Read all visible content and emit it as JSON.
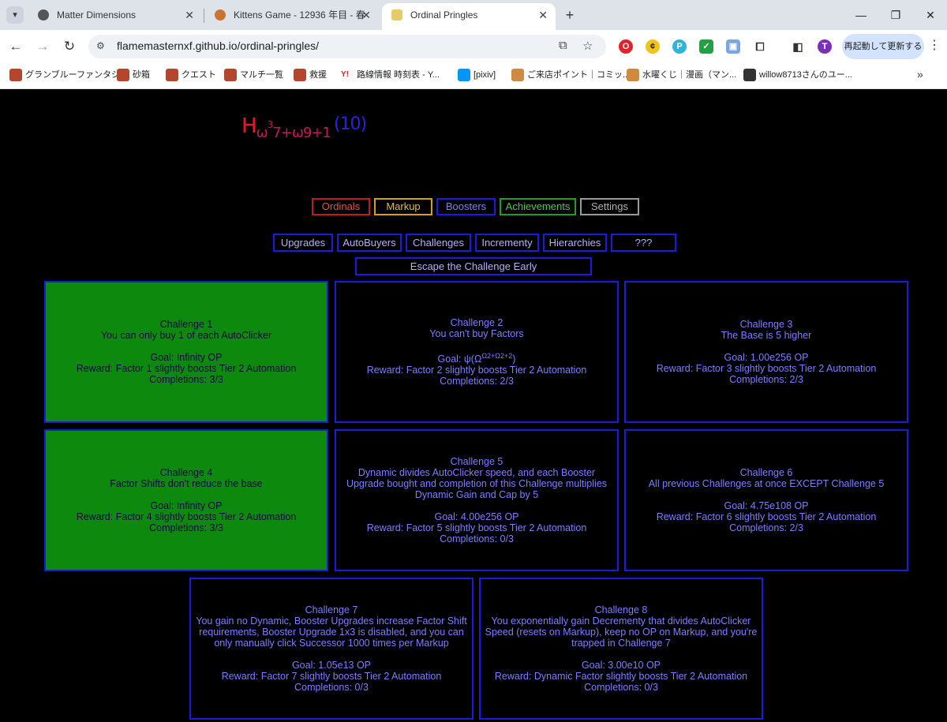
{
  "browser": {
    "tabs": [
      {
        "title": "Matter Dimensions",
        "active": false
      },
      {
        "title": "Kittens Game - 12936 年目 - 春",
        "active": false
      },
      {
        "title": "Ordinal Pringles",
        "active": true
      }
    ],
    "url": "flamemasternxf.github.io/ordinal-pringles/",
    "update_button": "再起動して更新する",
    "profile_initial": "T",
    "bookmarks": [
      "グランブルーファンタジー",
      "砂箱",
      "クエスト",
      "マルチ一覧",
      "救援",
      "路線情報 時刻表 - Y...",
      "[pixiv]",
      "ご来店ポイント｜コミッ...",
      "水曜くじ｜漫画（マン...",
      "willow8713さんのユー..."
    ],
    "colors": {
      "tabbar": "#dee3ea",
      "update_button": "#d3e3fd"
    }
  },
  "game": {
    "title": {
      "h": "H",
      "omega_part": "ω",
      "exp": "3",
      "rest": "7+ω9+1",
      "base": "(10)"
    },
    "main_tabs": [
      {
        "label": "Ordinals",
        "color": "#c01a1a"
      },
      {
        "label": "Markup",
        "color": "#d4a017"
      },
      {
        "label": "Boosters",
        "color": "#1a1ae0"
      },
      {
        "label": "Achievements",
        "color": "#1aa01a"
      },
      {
        "label": "Settings",
        "color": "#9a9a9a"
      }
    ],
    "sub_tabs": [
      "Upgrades",
      "AutoBuyers",
      "Challenges",
      "Incrementy",
      "Hierarchies",
      "???"
    ],
    "escape_label": "Escape the Challenge Early",
    "challenges": [
      {
        "name": "Challenge 1",
        "desc": "You can only buy 1 of each AutoClicker",
        "goal": "Goal: Infinity OP",
        "reward": "Reward: Factor 1 slightly boosts Tier 2 Automation",
        "completions": "Completions: 3/3",
        "complete": true
      },
      {
        "name": "Challenge 2",
        "desc": "You can't buy Factors",
        "goal_prefix": "Goal: ψ(Ω",
        "goal_sup": "Ω2+Ω2+2",
        "goal_suffix": ")",
        "reward": "Reward: Factor 2 slightly boosts Tier 2 Automation",
        "completions": "Completions: 2/3",
        "complete": false
      },
      {
        "name": "Challenge 3",
        "desc": "The Base is 5 higher",
        "goal": "Goal: 1.00e256 OP",
        "reward": "Reward: Factor 3 slightly boosts Tier 2 Automation",
        "completions": "Completions: 2/3",
        "complete": false
      },
      {
        "name": "Challenge 4",
        "desc": "Factor Shifts don't reduce the base",
        "goal": "Goal: Infinity OP",
        "reward": "Reward: Factor 4 slightly boosts Tier 2 Automation",
        "completions": "Completions: 3/3",
        "complete": true
      },
      {
        "name": "Challenge 5",
        "desc": "Dynamic divides AutoClicker speed, and each Booster Upgrade bought and completion of this Challenge multiplies Dynamic Gain and Cap by 5",
        "goal": "Goal: 4.00e256 OP",
        "reward": "Reward: Factor 5 slightly boosts Tier 2 Automation",
        "completions": "Completions: 0/3",
        "complete": false
      },
      {
        "name": "Challenge 6",
        "desc": "All previous Challenges at once EXCEPT Challenge 5",
        "goal": "Goal: 4.75e108 OP",
        "reward": "Reward: Factor 6 slightly boosts Tier 2 Automation",
        "completions": "Completions: 2/3",
        "complete": false
      },
      {
        "name": "Challenge 7",
        "desc": "You gain no Dynamic, Booster Upgrades increase Factor Shift requirements, Booster Upgrade 1x3 is disabled, and you can only manually click Successor 1000 times per Markup",
        "goal": "Goal: 1.05e13 OP",
        "reward": "Reward: Factor 7 slightly boosts Tier 2 Automation",
        "completions": "Completions: 0/3",
        "complete": false
      },
      {
        "name": "Challenge 8",
        "desc": "You exponentially gain Decrementy that divides AutoClicker Speed (resets on Markup), keep no OP on Markup, and you're trapped in Challenge 7",
        "goal": "Goal: 3.00e10 OP",
        "reward": "Reward: Dynamic Factor slightly boosts Tier 2 Automation",
        "completions": "Completions: 0/3",
        "complete": false
      }
    ],
    "colors": {
      "complete_bg": "#0d8a0d",
      "border": "#1a1ae0",
      "text": "#7d7dff"
    }
  }
}
